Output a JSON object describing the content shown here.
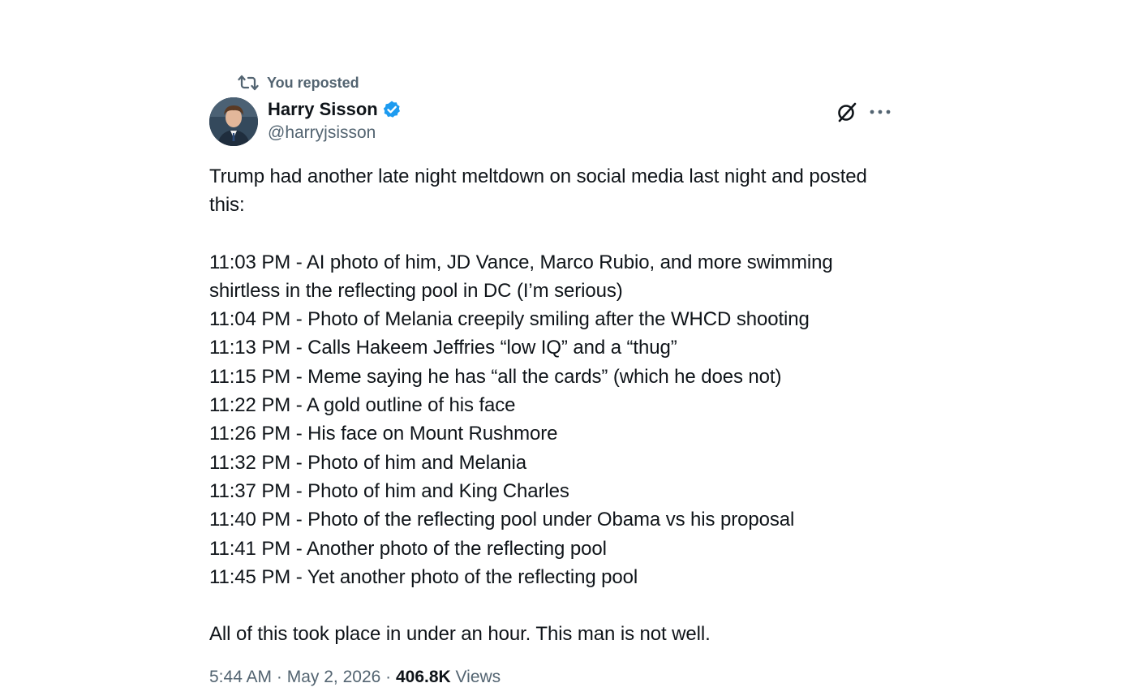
{
  "repost": {
    "label": "You reposted",
    "icon": "repost-icon"
  },
  "author": {
    "display_name": "Harry Sisson",
    "handle": "@harryjsisson",
    "verified": true,
    "badge_color": "#1d9bf0"
  },
  "actions": {
    "grok_icon": "grok-icon",
    "more_icon": "more-icon"
  },
  "tweet": {
    "intro": "Trump had another late night meltdown on social media last night and posted this:",
    "timeline": [
      "11:03 PM - AI photo of him, JD Vance, Marco Rubio, and more swimming shirtless in the reflecting pool in DC (I’m serious)",
      "11:04 PM - Photo of Melania creepily smiling after the WHCD shooting",
      "11:13 PM - Calls Hakeem Jeffries “low IQ” and a “thug”",
      "11:15 PM - Meme saying he has “all the cards” (which he does not)",
      "11:22 PM - A gold outline of his face",
      "11:26 PM - His face on Mount Rushmore",
      "11:32 PM - Photo of him and Melania",
      "11:37 PM - Photo of him and King Charles",
      "11:40 PM - Photo of the reflecting pool under Obama vs his proposal",
      "11:41 PM - Another photo of the reflecting pool",
      "11:45 PM - Yet another photo of the reflecting pool"
    ],
    "closing": "All of this took place in under an hour. This man is not well."
  },
  "meta": {
    "time": "5:44 AM",
    "date": "May 2, 2026",
    "separator": " · ",
    "views_count": "406.8K",
    "views_label": "Views"
  },
  "colors": {
    "text": "#0f1419",
    "secondary": "#536471",
    "accent": "#1d9bf0"
  }
}
